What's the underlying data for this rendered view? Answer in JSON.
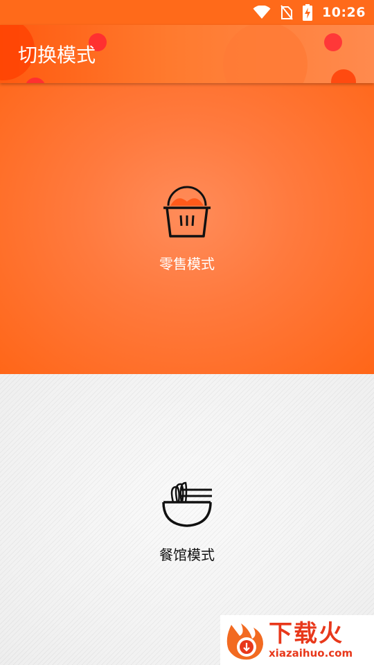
{
  "status_bar": {
    "time": "10:26",
    "icons": [
      "wifi-icon",
      "no-sim-icon",
      "battery-charging-icon"
    ]
  },
  "app_bar": {
    "title": "切换模式"
  },
  "modes": [
    {
      "label": "零售模式",
      "icon": "shopping-basket-icon"
    },
    {
      "label": "餐馆模式",
      "icon": "noodle-bowl-icon"
    }
  ],
  "watermark": {
    "title": "下载火",
    "url": "xiazaihuo.com"
  },
  "colors": {
    "accent": "#ff6a1a",
    "retail_bg": "#ff7a3e",
    "restaurant_bg": "#f2f2f2",
    "watermark_red": "#e8381b"
  }
}
